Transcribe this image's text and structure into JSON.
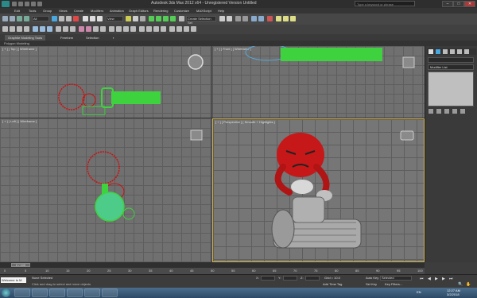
{
  "window": {
    "title": "Autodesk 3ds Max 2012 x64 - Unregistered Version Untitled",
    "search_placeholder": "Type a keyword or phrase",
    "minimize": "–",
    "maximize": "□",
    "close": "✕"
  },
  "menu": [
    "Edit",
    "Tools",
    "Group",
    "Views",
    "Create",
    "Modifiers",
    "Animation",
    "Graph Editors",
    "Rendering",
    "Customize",
    "MAXScript",
    "Help"
  ],
  "toolbar": {
    "selection_filter": "All",
    "reference_coord": "View",
    "named_selection": "Create Selection Set"
  },
  "ribbon": {
    "tabs": [
      "Graphite Modeling Tools",
      "Freeform",
      "Selection"
    ],
    "subtitle": "Polygon Modeling"
  },
  "viewports": {
    "top": "[ + ] [ Top ] [ Wireframe ]",
    "front": "[ + ] [ Front ] [ Wireframe ]",
    "left": "[ + ] [ Left ] [ Wireframe ]",
    "perspective": "[ + ] [ Perspective ] [ Smooth + Highlights ]"
  },
  "command_panel": {
    "modifier_list": "Modifier List"
  },
  "timeline": {
    "counter": "0 / 100",
    "ticks": [
      "0",
      "5",
      "10",
      "15",
      "20",
      "25",
      "30",
      "35",
      "40",
      "45",
      "50",
      "55",
      "60",
      "65",
      "70",
      "75",
      "80",
      "85",
      "90",
      "95",
      "100"
    ]
  },
  "status": {
    "selection": "None Selected",
    "prompt": "Click and drag to select and move objects",
    "listener": "Welcome to M",
    "grid": "Grid = 10.0",
    "add_time_tag": "Add Time Tag",
    "auto_key": "Auto Key",
    "set_key": "Set Key",
    "key_mode": "Selected",
    "key_filters": "Key Filters...",
    "x_label": "X:",
    "y_label": "Y:",
    "z_label": "Z:"
  },
  "taskbar": {
    "language": "EN",
    "time": "12:27 AM",
    "date": "3/2/2018"
  },
  "colors": {
    "bone_green": "#3fd23f",
    "character_red": "#cc1a1a",
    "viewport_bg": "#707070",
    "active_border": "#d8b84a"
  }
}
